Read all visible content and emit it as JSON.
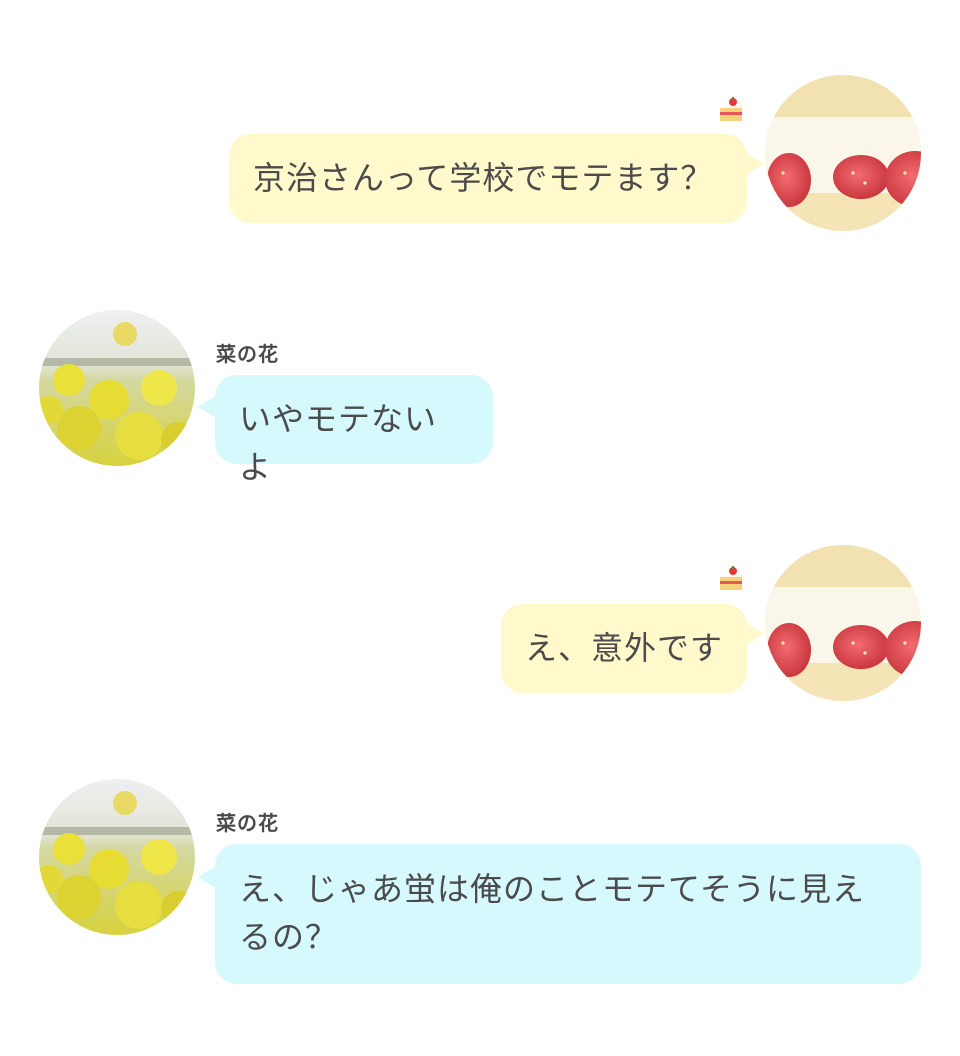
{
  "colors": {
    "my_bubble": "#fff9cb",
    "their_bubble": "#d6f9fd",
    "text": "#4b4b4b"
  },
  "messages": [
    {
      "side": "right",
      "sender_icon": "shortcake-icon",
      "avatar": "strawberry-sandwich-avatar",
      "text": "京治さんって学校でモテます？"
    },
    {
      "side": "left",
      "sender_name": "菜の花",
      "avatar": "rapeseed-flower-avatar",
      "text": "いやモテないよ"
    },
    {
      "side": "right",
      "sender_icon": "shortcake-icon",
      "avatar": "strawberry-sandwich-avatar",
      "text": "え、意外です"
    },
    {
      "side": "left",
      "sender_name": "菜の花",
      "avatar": "rapeseed-flower-avatar",
      "text": "え、じゃあ蛍は俺のことモテてそうに見えるの？"
    }
  ]
}
